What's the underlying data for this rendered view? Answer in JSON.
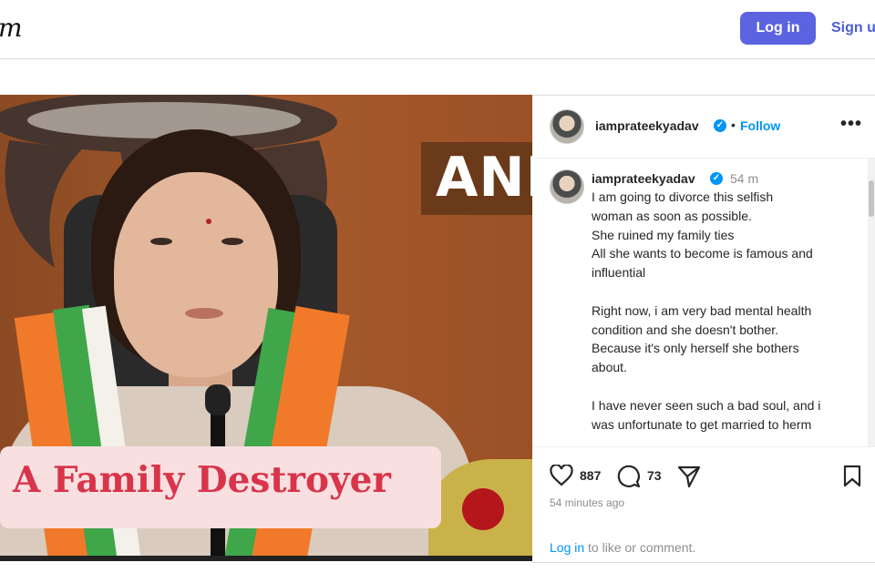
{
  "header": {
    "logo_text": "m",
    "login_label": "Log in",
    "signup_label": "Sign up"
  },
  "media": {
    "watermark": "ANI",
    "caption_overlay": "A Family Destroyer"
  },
  "post": {
    "username": "iamprateekyadav",
    "separator": "•",
    "follow_label": "Follow",
    "more_label": "•••",
    "time_short": "54 m",
    "caption_lines": [
      "I am going to divorce this selfish",
      "woman as soon as possible.",
      "She ruined my family ties",
      "All she wants to become is famous and",
      "influential",
      "",
      "Right now, i am very bad mental health",
      "condition and she doesn't bother.",
      "Because it's only herself she bothers",
      "about.",
      "",
      "I have never seen such a bad soul, and i",
      "was unfortunate to get married to herm"
    ],
    "likes": "887",
    "comments": "73",
    "posted_ago": "54 minutes ago",
    "login_link": "Log in",
    "login_suffix": " to like or comment."
  },
  "icons": {
    "verified": "verified-badge-icon",
    "like": "heart-icon",
    "comment": "comment-icon",
    "share": "send-icon",
    "save": "bookmark-icon"
  },
  "colors": {
    "login_button": "#5b63e0",
    "link_blue": "#0095f6",
    "caption_overlay_text": "#d8344a",
    "caption_overlay_bg": "#f9dfe0"
  }
}
